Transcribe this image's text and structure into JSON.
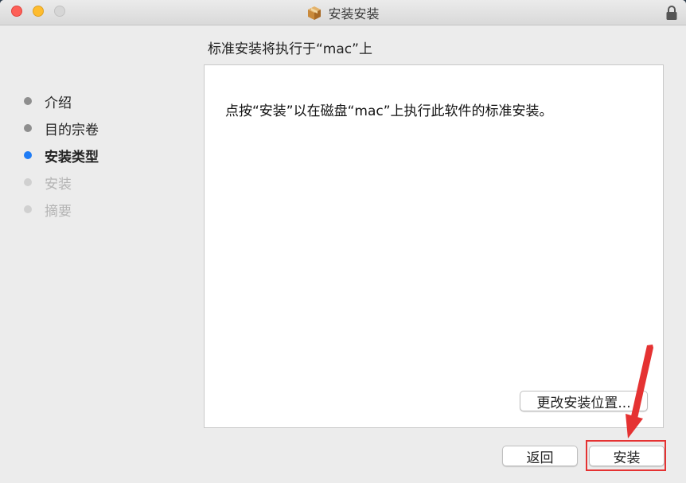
{
  "window": {
    "title": "安装安装"
  },
  "sidebar": {
    "steps": [
      {
        "label": "介绍",
        "state": "done"
      },
      {
        "label": "目的宗卷",
        "state": "done"
      },
      {
        "label": "安装类型",
        "state": "current"
      },
      {
        "label": "安装",
        "state": "pending"
      },
      {
        "label": "摘要",
        "state": "pending"
      }
    ]
  },
  "main": {
    "heading": "标准安装将执行于“mac”上",
    "description": "点按“安装”以在磁盘“mac”上执行此软件的标准安装。",
    "change_location_label": "更改安装位置..."
  },
  "footer": {
    "back_label": "返回",
    "install_label": "安装"
  },
  "colors": {
    "accent": "#1f7cf5",
    "annotation": "#e53232"
  }
}
